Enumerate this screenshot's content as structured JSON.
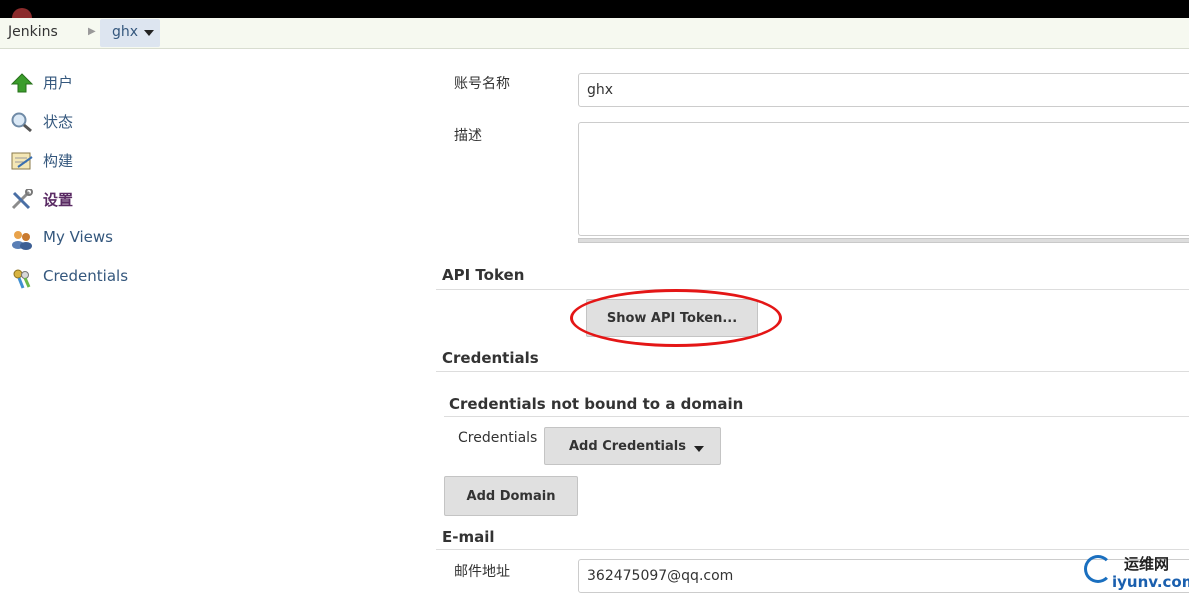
{
  "breadcrumb": {
    "root": "Jenkins",
    "current": "ghx"
  },
  "sidebar": {
    "items": [
      {
        "label": "用户",
        "icon": "up-arrow-icon"
      },
      {
        "label": "状态",
        "icon": "magnifier-icon"
      },
      {
        "label": "构建",
        "icon": "notepad-icon"
      },
      {
        "label": "设置",
        "icon": "wrench-screwdriver-icon"
      },
      {
        "label": "My Views",
        "icon": "users-icon"
      },
      {
        "label": "Credentials",
        "icon": "keys-icon"
      }
    ]
  },
  "form": {
    "account_name_label": "账号名称",
    "account_name_value": "ghx",
    "description_label": "描述",
    "api_token_title": "API Token",
    "show_api_token_button": "Show API Token...",
    "credentials_title": "Credentials",
    "credentials_subtitle": "Credentials not bound to a domain",
    "credentials_label": "Credentials",
    "add_credentials_button": "Add Credentials",
    "add_domain_button": "Add Domain",
    "email_title": "E-mail",
    "email_label": "邮件地址",
    "email_value": "362475097@qq.com"
  },
  "watermark": {
    "line1": "运维网",
    "line2": "iyunv.com"
  },
  "colors": {
    "link": "#34577d",
    "highlight": "#e41616",
    "active": "#5a2b64"
  }
}
